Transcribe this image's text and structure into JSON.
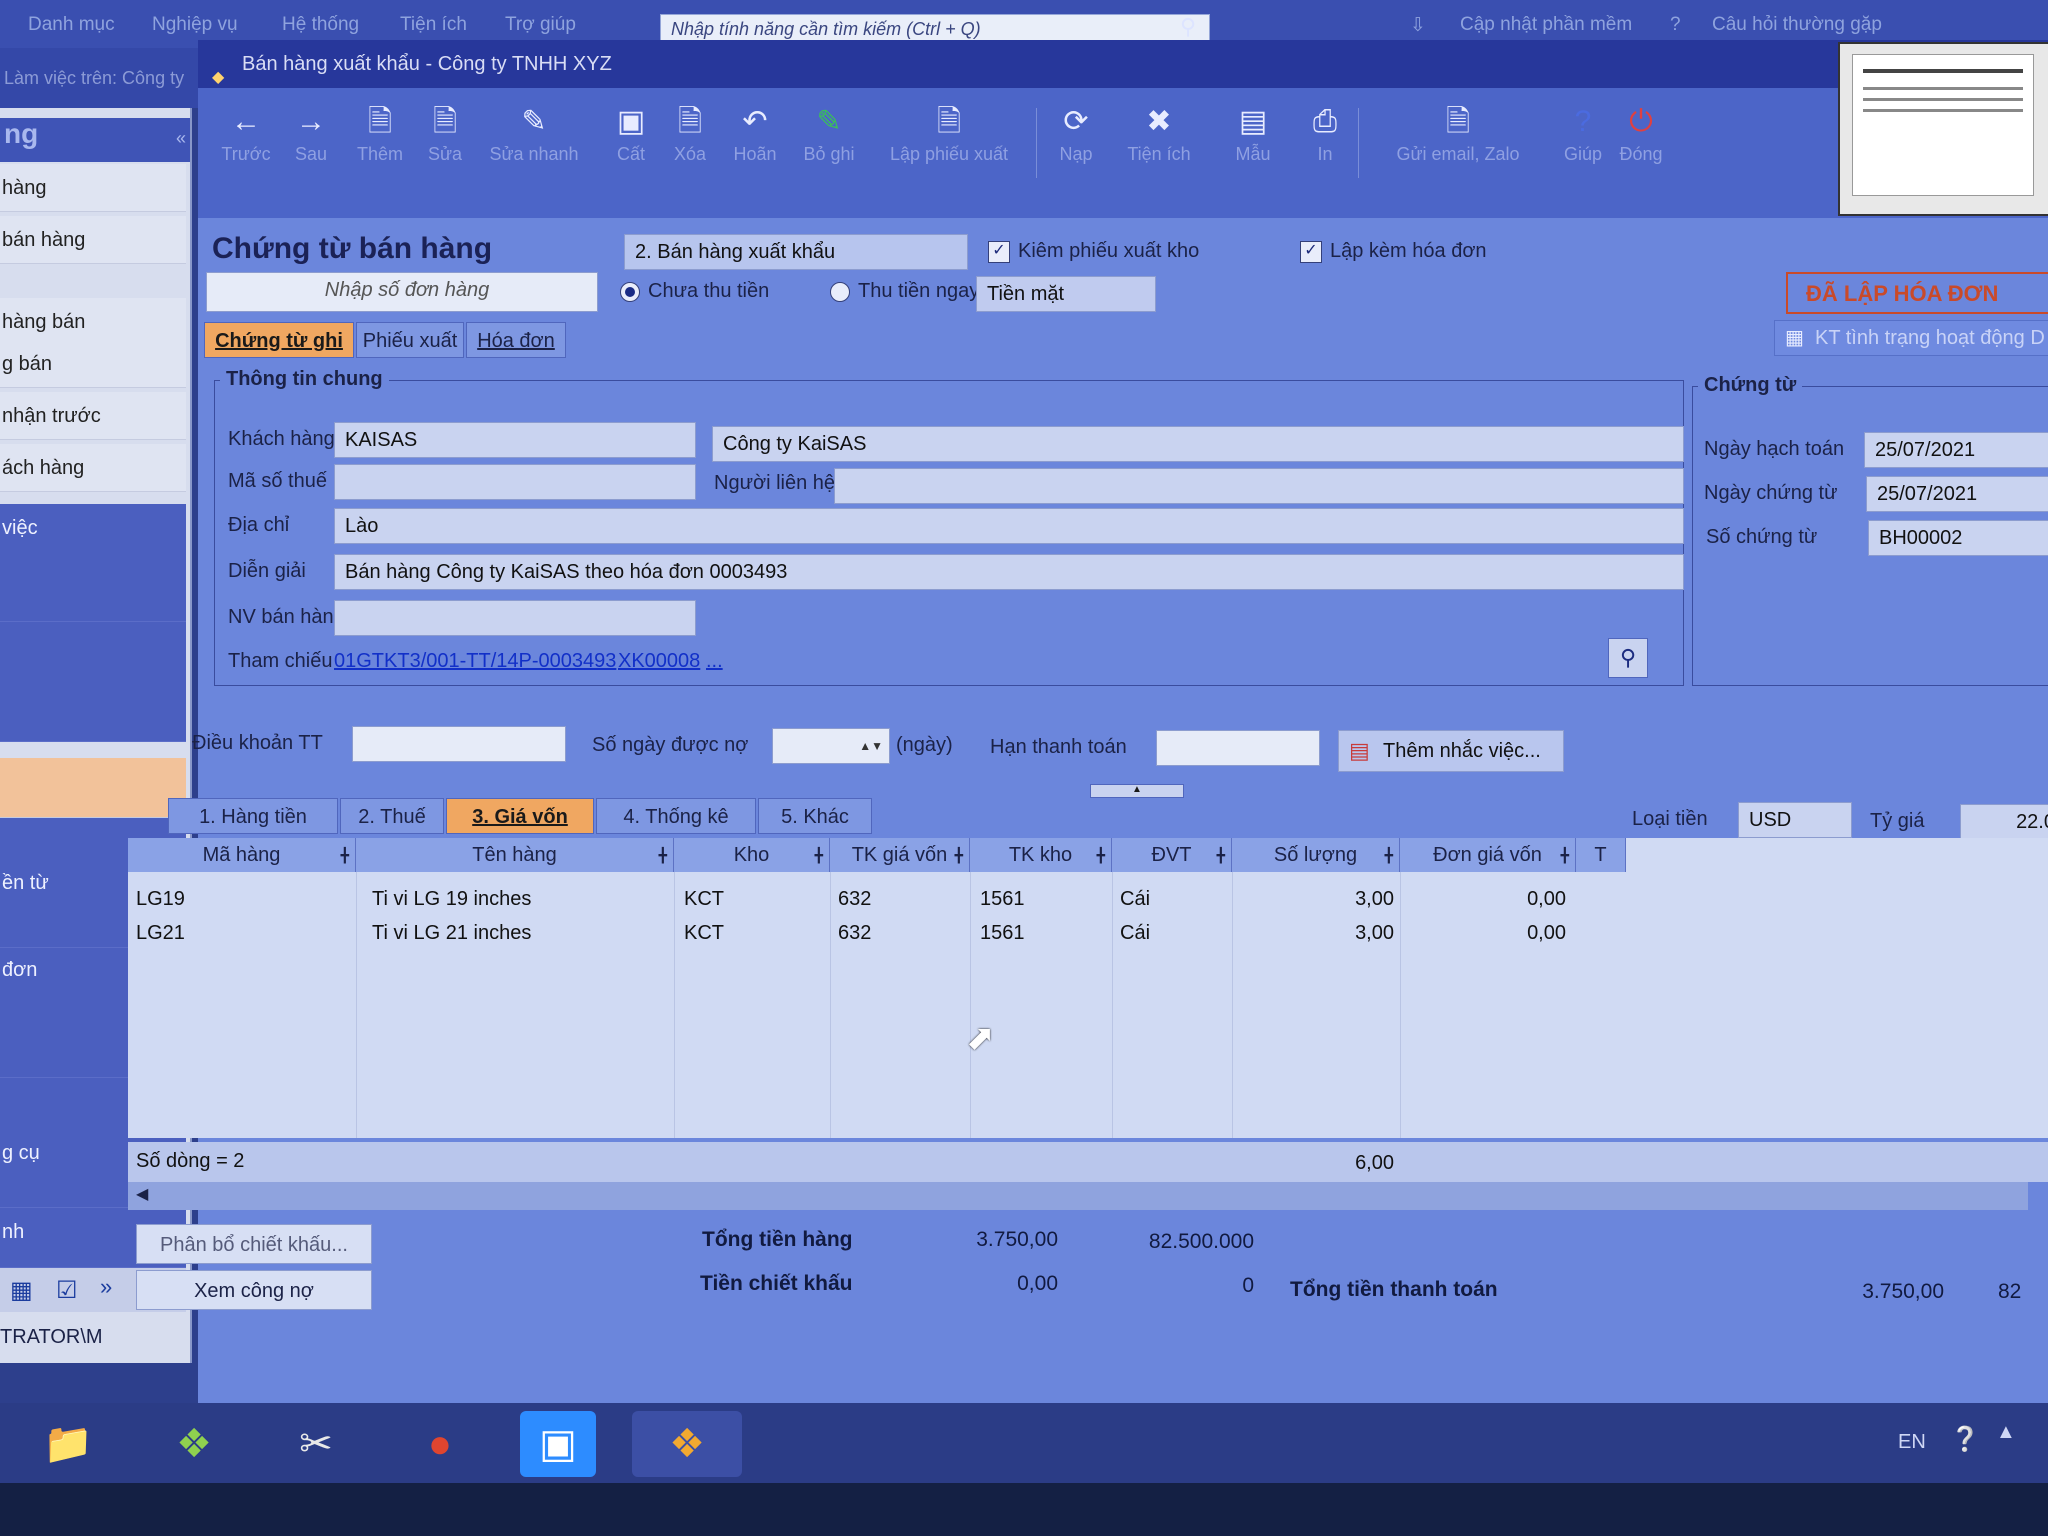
{
  "app_topbar": {
    "menus": [
      "Danh mục",
      "Nghiệp vụ",
      "Hệ thống",
      "Tiện ích",
      "Trợ giúp"
    ],
    "search_placeholder": "Nhập tính năng cần tìm kiếm (Ctrl + Q)",
    "update_label": "Cập nhật phần mềm",
    "faq_label": "Câu hỏi thường gặp",
    "sub_label": "Làm việc trên: Công ty"
  },
  "left_nav": {
    "title": "ng",
    "items": [
      "hàng",
      "bán hàng",
      "hàng bán",
      "g bán",
      "nhận trước",
      "ách hàng",
      "việc",
      "",
      "ền từ",
      "đơn",
      "g cụ",
      "nh"
    ],
    "user": "TRATOR\\M"
  },
  "window": {
    "title": "Bán hàng xuất khẩu - Công ty TNHH XYZ"
  },
  "toolbar": {
    "buttons": [
      {
        "icon": "arrow-left-icon",
        "label": "Trước"
      },
      {
        "icon": "arrow-right-icon",
        "label": "Sau"
      },
      {
        "icon": "add-doc-icon",
        "label": "Thêm"
      },
      {
        "icon": "edit-doc-icon",
        "label": "Sửa"
      },
      {
        "icon": "quick-edit-icon",
        "label": "Sửa nhanh"
      },
      {
        "icon": "save-icon",
        "label": "Cất"
      },
      {
        "icon": "delete-icon",
        "label": "Xóa"
      },
      {
        "icon": "undo-icon",
        "label": "Hoãn"
      },
      {
        "icon": "post-icon",
        "label": "Bỏ ghi"
      },
      {
        "icon": "create-slip-icon",
        "label": "Lập phiếu xuất"
      },
      {
        "icon": "reload-icon",
        "label": "Nạp"
      },
      {
        "icon": "tools-icon",
        "label": "Tiện ích"
      },
      {
        "icon": "template-icon",
        "label": "Mẫu"
      },
      {
        "icon": "print-icon",
        "label": "In"
      },
      {
        "icon": "send-icon",
        "label": "Gửi email, Zalo"
      },
      {
        "icon": "help-icon",
        "label": "Giúp"
      },
      {
        "icon": "close-icon",
        "label": "Đóng"
      }
    ]
  },
  "form": {
    "heading": "Chứng từ bán hàng",
    "sale_type": "2. Bán hàng xuất khẩu",
    "check_export_slip": "Kiêm phiếu xuất kho",
    "check_invoice": "Lập kèm hóa đơn",
    "order_input_placeholder": "Nhập số đơn hàng",
    "radio_unpaid": "Chưa thu tiền",
    "radio_paid": "Thu tiền ngay",
    "payment_method": "Tiền mặt",
    "invoice_status": "ĐÃ LẬP HÓA ĐƠN",
    "check_status_btn": "KT tình trạng hoạt động D",
    "tabs": [
      "Chứng từ ghi nợ",
      "Phiếu xuất",
      "Hóa đơn"
    ],
    "general": {
      "title": "Thông tin chung",
      "customer_label": "Khách hàng",
      "customer_code": "KAISAS",
      "customer_name": "Công ty KaiSAS",
      "tax_label": "Mã số thuế",
      "tax_value": "",
      "contact_label": "Người liên hệ",
      "contact_value": "",
      "address_label": "Địa chỉ",
      "address_value": "Lào",
      "desc_label": "Diễn giải",
      "desc_value": "Bán hàng Công ty KaiSAS theo hóa đơn 0003493",
      "staff_label": "NV bán hàng",
      "staff_value": "",
      "ref_label": "Tham chiếu",
      "ref_link1": "01GTKT3/001-TT/14P-0003493",
      "ref_link2": "XK00008",
      "ref_more": "..."
    },
    "voucher": {
      "title": "Chứng từ",
      "posting_date_label": "Ngày hạch toán",
      "posting_date": "25/07/2021",
      "voucher_date_label": "Ngày chứng từ",
      "voucher_date": "25/07/2021",
      "voucher_no_label": "Số chứng từ",
      "voucher_no": "BH00002"
    },
    "terms_label": "Điều khoản TT",
    "terms_value": "",
    "credit_days_label": "Số ngày được nợ",
    "credit_days_unit": "(ngày)",
    "due_label": "Hạn thanh toán",
    "due_value": "",
    "reminder_btn": "Thêm nhắc việc...",
    "currency_label": "Loại tiền",
    "currency_value": "USD",
    "rate_label": "Tỷ giá",
    "rate_value": "22.0"
  },
  "detail_tabs": [
    "1. Hàng tiền",
    "2. Thuế",
    "3. Giá vốn",
    "4. Thống kê",
    "5. Khác"
  ],
  "grid": {
    "columns": [
      "Mã hàng",
      "Tên hàng",
      "Kho",
      "TK giá vốn",
      "TK kho",
      "ĐVT",
      "Số lượng",
      "Đơn giá vốn",
      "T"
    ],
    "rows": [
      {
        "code": "LG19",
        "name": "Ti vi LG 19 inches",
        "warehouse": "KCT",
        "cost_acc": "632",
        "stock_acc": "1561",
        "unit": "Cái",
        "qty": "3,00",
        "unit_cost": "0,00"
      },
      {
        "code": "LG21",
        "name": "Ti vi LG 21 inches",
        "warehouse": "KCT",
        "cost_acc": "632",
        "stock_acc": "1561",
        "unit": "Cái",
        "qty": "3,00",
        "unit_cost": "0,00"
      }
    ],
    "row_count": "Số dòng = 2",
    "qty_total": "6,00"
  },
  "bottom": {
    "discount_btn": "Phân bổ chiết khấu...",
    "debt_btn": "Xem công nợ",
    "total_goods_label": "Tổng tiền hàng",
    "total_goods_usd": "3.750,00",
    "total_goods_vnd": "82.500.000",
    "discount_label": "Tiền chiết khấu",
    "discount_usd": "0,00",
    "discount_vnd": "0",
    "total_pay_label": "Tổng tiền thanh toán",
    "total_pay_usd": "3.750,00",
    "total_pay_vnd_partial": "82"
  },
  "taskbar": {
    "lang": "EN"
  }
}
